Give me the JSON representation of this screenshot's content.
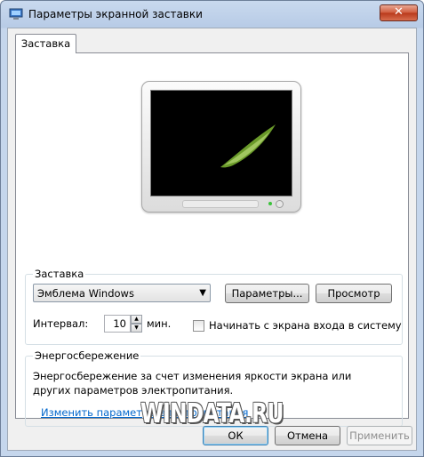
{
  "window": {
    "title": "Параметры экранной заставки",
    "close_label": "✕"
  },
  "tabs": [
    {
      "label": "Заставка",
      "selected": true
    }
  ],
  "screensaver": {
    "group_title": "Заставка",
    "selected": "Эмблема Windows",
    "settings_label": "Параметры...",
    "preview_label": "Просмотр",
    "interval_label": "Интервал:",
    "interval_value": "10",
    "interval_unit": "мин.",
    "resume_logon_label": "Начинать с экрана входа в систему",
    "resume_logon_checked": false
  },
  "power": {
    "group_title": "Энергосбережение",
    "description": "Энергосбережение за счет изменения яркости экрана или других параметров электропитания.",
    "link_label": "Изменить параметры электропитания"
  },
  "footer": {
    "ok_label": "ОК",
    "cancel_label": "Отмена",
    "apply_label": "Применить"
  },
  "watermark": "WINDATA.RU",
  "colors": {
    "link": "#0066cc",
    "screen": "#000000",
    "logo_green": "#6a9a2a"
  }
}
